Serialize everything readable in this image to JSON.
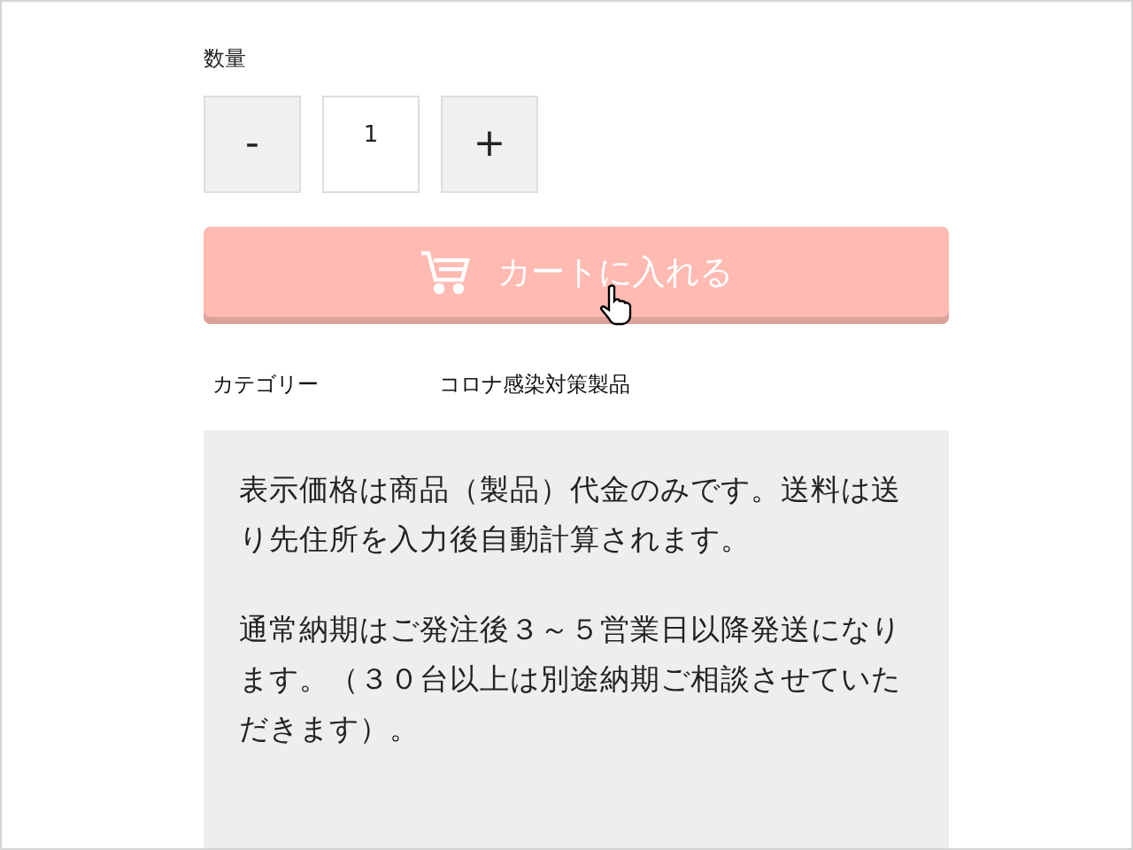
{
  "quantity": {
    "label": "数量",
    "decrement": "-",
    "value": "1",
    "increment": "+"
  },
  "cart_button": {
    "label": "カートに入れる",
    "disabled": true
  },
  "category": {
    "label": "カテゴリー",
    "value": "コロナ感染対策製品"
  },
  "notice": {
    "paragraphs": [
      "表示価格は商品（製品）代金のみです。送料は送り先住所を入力後自動計算されます。",
      "通常納期はご発注後３～５営業日以降発送になります。（３０台以上は別途納期ご相談させていただきます）。"
    ]
  }
}
